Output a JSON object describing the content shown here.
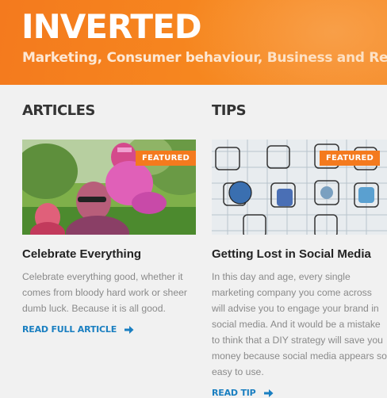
{
  "header": {
    "title": "INVERTED",
    "tagline": "Marketing, Consumer behaviour, Business and Reflection"
  },
  "articles": {
    "heading": "ARTICLES",
    "badge": "FEATURED",
    "title": "Celebrate Everything",
    "text": "Celebrate everything good, whether it comes from bloody hard work or sheer dumb luck. Because it is all good.",
    "link": "READ FULL ARTICLE"
  },
  "tips": {
    "heading": "TIPS",
    "badge": "FEATURED",
    "title": "Getting Lost in Social Media",
    "text": "In this day and age, every single marketing company you come across will advise you to engage your brand in social media. And it would be a mistake to think that a DIY strategy will save you money because social media appears so easy to use.",
    "link": "READ TIP"
  },
  "colors": {
    "brand_orange": "#f47a1e",
    "link_blue": "#1a7fc1"
  }
}
